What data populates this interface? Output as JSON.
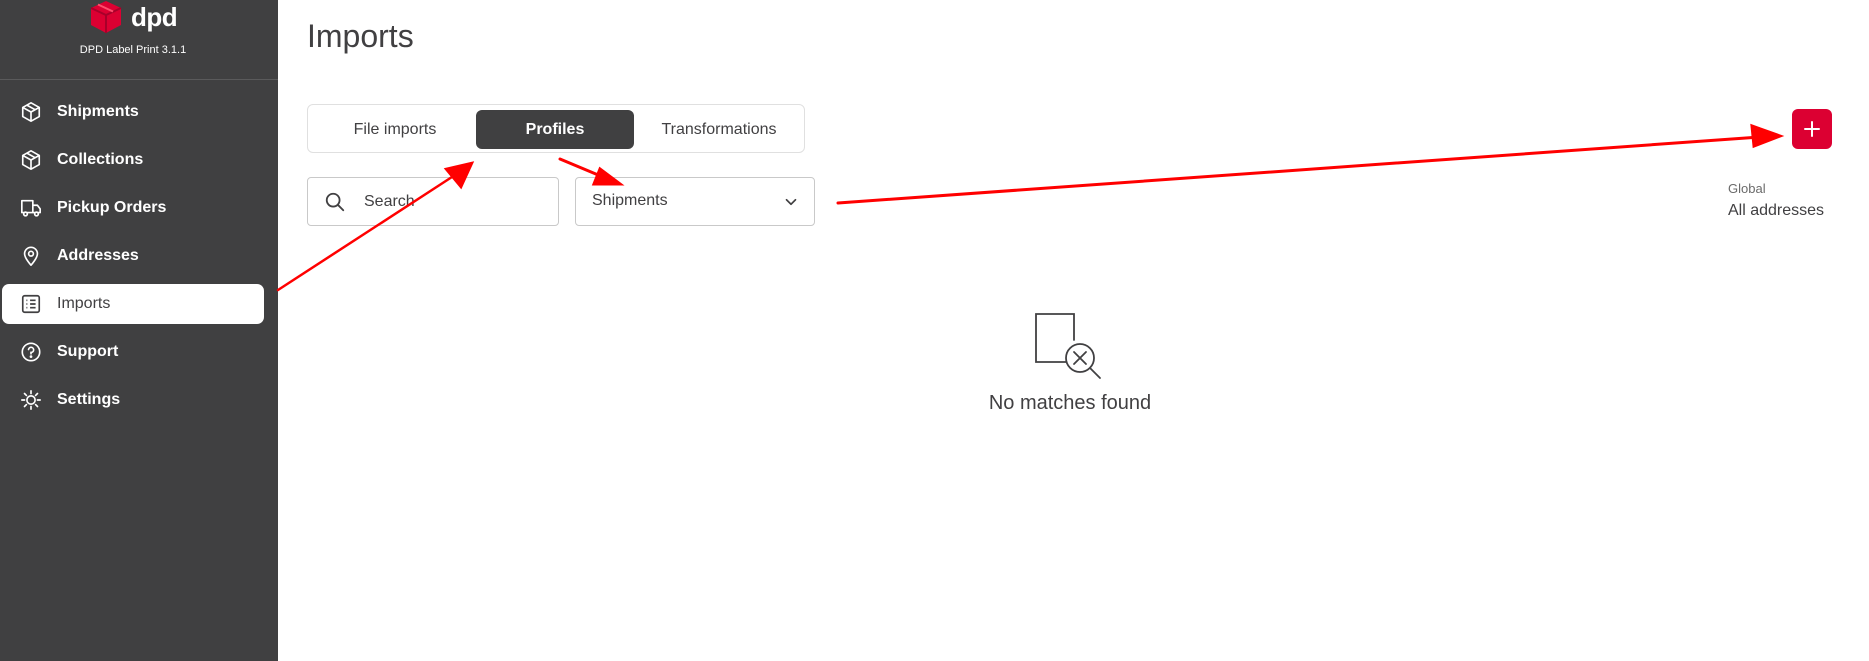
{
  "app": {
    "brand_name": "dpd",
    "version": "DPD Label Print 3.1.1",
    "accent_color": "#dc0032"
  },
  "sidebar": {
    "items": [
      {
        "label": "Shipments",
        "icon": "package-icon",
        "active": false
      },
      {
        "label": "Collections",
        "icon": "package-icon",
        "active": false
      },
      {
        "label": "Pickup Orders",
        "icon": "truck-icon",
        "active": false
      },
      {
        "label": "Addresses",
        "icon": "map-pin-icon",
        "active": false
      },
      {
        "label": "Imports",
        "icon": "list-icon",
        "active": true
      },
      {
        "label": "Support",
        "icon": "help-circle-icon",
        "active": false
      },
      {
        "label": "Settings",
        "icon": "gear-icon",
        "active": false
      }
    ]
  },
  "main": {
    "title": "Imports",
    "tabs": [
      {
        "label": "File imports",
        "selected": false
      },
      {
        "label": "Profiles",
        "selected": true
      },
      {
        "label": "Transformations",
        "selected": false
      }
    ],
    "search": {
      "placeholder": "Search",
      "value": ""
    },
    "type_select": {
      "value": "Shipments"
    },
    "add_button_label": "+",
    "scope": {
      "label": "Global",
      "value": "All addresses"
    },
    "empty_state": {
      "message": "No matches found",
      "icon": "no-results-icon"
    }
  }
}
